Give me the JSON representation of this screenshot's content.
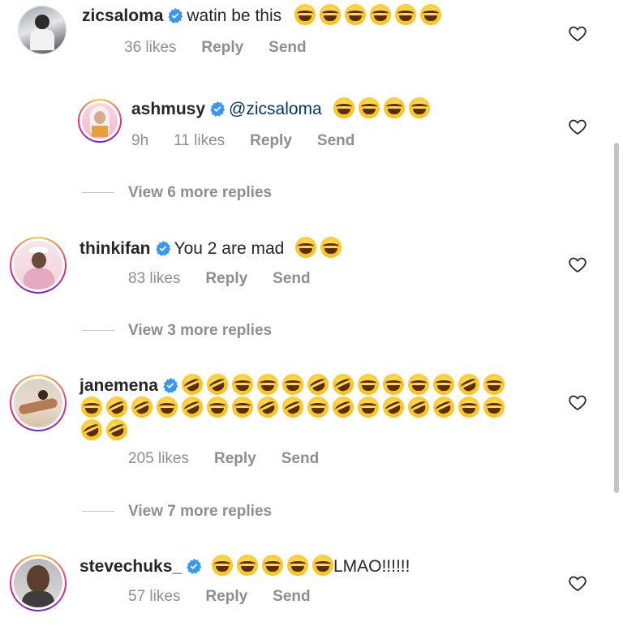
{
  "comments": [
    {
      "username": "zicsaloma",
      "text": "watin be this",
      "emojis": [
        "joy",
        "joy",
        "joy",
        "joy",
        "joy",
        "joy"
      ],
      "meta": {
        "likes": "36 likes",
        "reply": "Reply",
        "send": "Send"
      }
    },
    {
      "username": "ashmusy",
      "mention": "@zicsaloma",
      "emojis": [
        "joy",
        "joy",
        "joy",
        "joy"
      ],
      "meta": {
        "time": "9h",
        "likes": "11 likes",
        "reply": "Reply",
        "send": "Send"
      }
    },
    {
      "username": "thinkifan",
      "text": "You 2 are mad",
      "emojis": [
        "joy",
        "joy"
      ],
      "meta": {
        "likes": "83 likes",
        "reply": "Reply",
        "send": "Send"
      }
    },
    {
      "username": "janemena",
      "emojis_line1": [
        "rofl",
        "rofl",
        "joy",
        "joy",
        "joy",
        "rofl",
        "rofl",
        "joy",
        "joy",
        "joy",
        "joy",
        "rofl",
        "joy"
      ],
      "emojis_line2": [
        "joy",
        "rofl",
        "rofl",
        "joy",
        "rofl",
        "joy",
        "joy",
        "rofl",
        "rofl",
        "joy",
        "rofl",
        "joy",
        "rofl",
        "rofl",
        "rofl",
        "joy",
        "joy"
      ],
      "emojis_line3": [
        "rofl",
        "rofl"
      ],
      "meta": {
        "likes": "205 likes",
        "reply": "Reply",
        "send": "Send"
      }
    },
    {
      "username": "stevechuks_",
      "emojis": [
        "joy",
        "joy",
        "joy",
        "joy",
        "joy"
      ],
      "text_after": "LMAO!!!!!!",
      "meta": {
        "likes": "57 likes",
        "reply": "Reply",
        "send": "Send"
      }
    }
  ],
  "view_replies": [
    "View 6 more replies",
    "View 3 more replies",
    "View 7 more replies"
  ],
  "icons": {
    "verified": "verified-badge-icon",
    "like": "heart-icon"
  },
  "colors": {
    "verified": "#3897f0",
    "secondary_text": "#8e8e8e",
    "mention": "#00376b"
  }
}
